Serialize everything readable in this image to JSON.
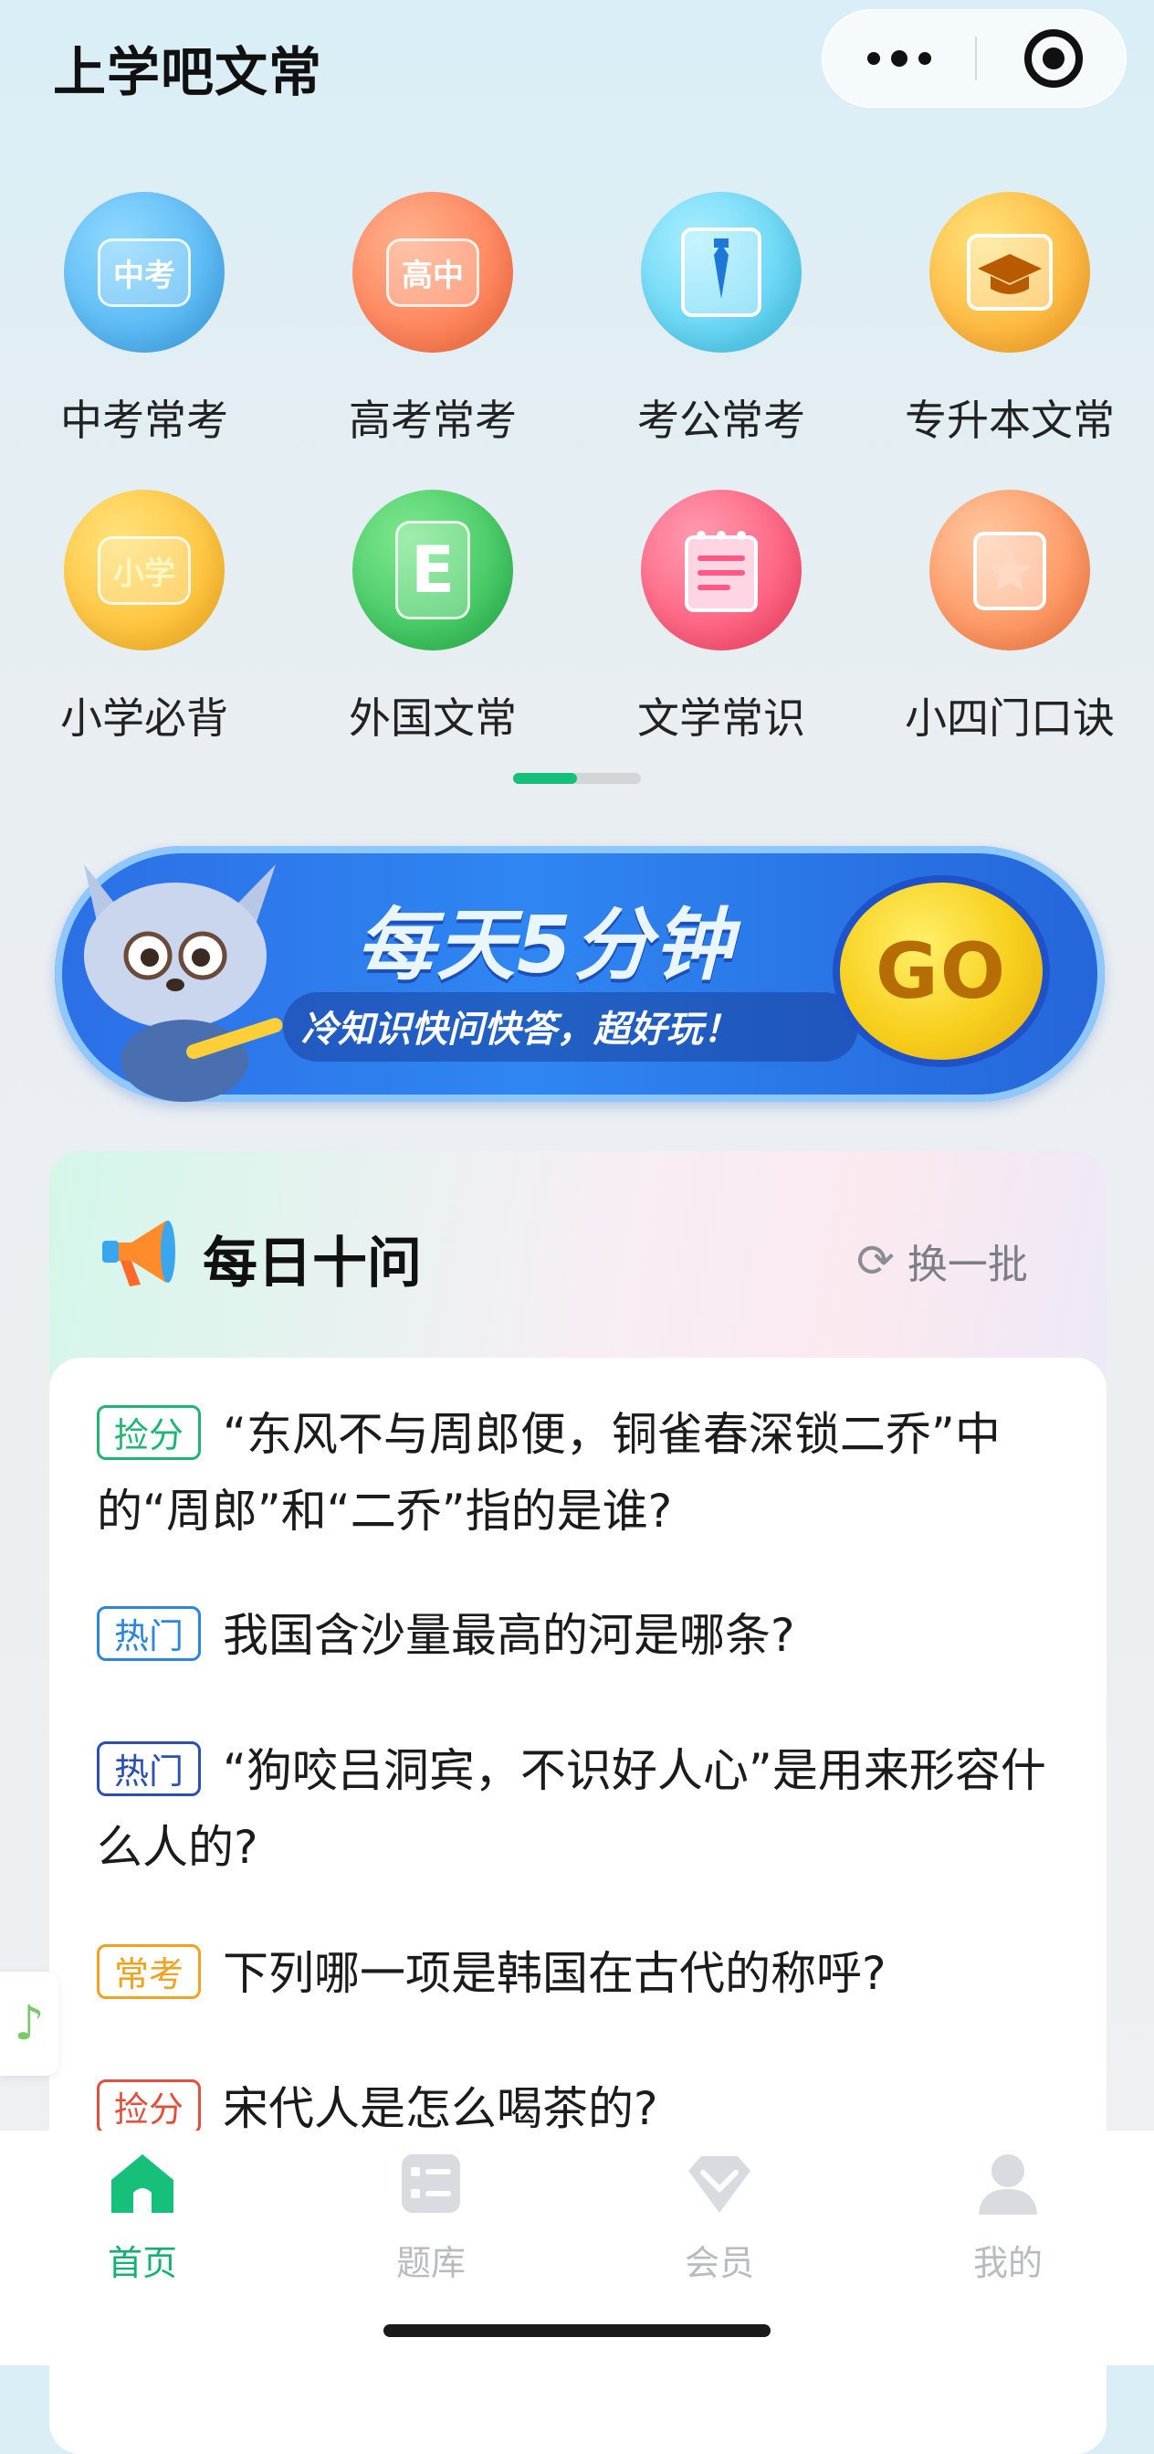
{
  "header": {
    "app_title": "上学吧文常"
  },
  "categories": [
    {
      "label": "中考常考",
      "icon": "zhongkao-book-icon",
      "badge": "中考",
      "color": "#4fb6f4"
    },
    {
      "label": "高考常考",
      "icon": "gaokao-book-icon",
      "badge": "高中",
      "color": "#ff7a4f"
    },
    {
      "label": "考公常考",
      "icon": "civil-exam-tie-icon",
      "badge": "",
      "color": "#59d3f2"
    },
    {
      "label": "专升本文常",
      "icon": "graduation-cap-icon",
      "badge": "",
      "color": "#ffb12c"
    },
    {
      "label": "小学必背",
      "icon": "primary-school-icon",
      "badge": "小学",
      "color": "#ffc127"
    },
    {
      "label": "外国文常",
      "icon": "foreign-book-icon",
      "badge": "E",
      "color": "#35c85a"
    },
    {
      "label": "文学常识",
      "icon": "notebook-icon",
      "badge": "",
      "color": "#ff5577"
    },
    {
      "label": "小四门口诀",
      "icon": "star-book-icon",
      "badge": "",
      "color": "#ff9354"
    }
  ],
  "banner": {
    "title": "每天5分钟",
    "subtitle": "冷知识快问快答，超好玩！",
    "go_label": "GO"
  },
  "daily": {
    "title": "每日十问",
    "refresh_label": "换一批",
    "questions": [
      {
        "tag": "捡分",
        "tag_color": "green",
        "text": "“东风不与周郎便，铜雀春深锁二乔”中的“周郎”和“二乔”指的是谁?"
      },
      {
        "tag": "热门",
        "tag_color": "blue",
        "text": "我国含沙量最高的河是哪条?"
      },
      {
        "tag": "热门",
        "tag_color": "navy",
        "text": "“狗咬吕洞宾，不识好人心”是用来形容什么人的?"
      },
      {
        "tag": "常考",
        "tag_color": "orange",
        "text": "下列哪一项是韩国在古代的称呼?"
      },
      {
        "tag": "捡分",
        "tag_color": "red",
        "text": "宋代人是怎么喝茶的?"
      }
    ]
  },
  "tabbar": {
    "items": [
      {
        "label": "首页",
        "icon": "home-icon",
        "active": true
      },
      {
        "label": "题库",
        "icon": "question-bank-icon",
        "active": false
      },
      {
        "label": "会员",
        "icon": "vip-diamond-icon",
        "active": false
      },
      {
        "label": "我的",
        "icon": "profile-icon",
        "active": false
      }
    ]
  },
  "colors": {
    "accent": "#16c07a",
    "banner_blue": "#2c6fe6"
  }
}
